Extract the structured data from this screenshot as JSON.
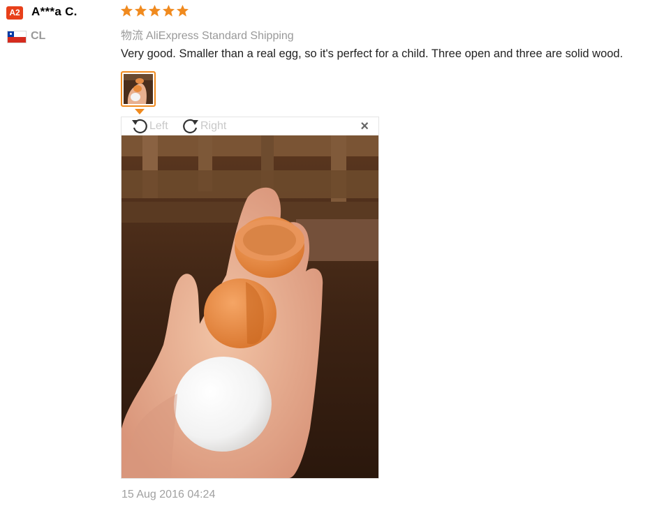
{
  "user": {
    "level": "A2",
    "name": "A***a C.",
    "country_code": "CL",
    "flag": "chile-flag"
  },
  "review": {
    "rating": 5,
    "rating_max": 5,
    "star_color": "#f08a1e",
    "logistics_label": "物流",
    "shipping_method": "AliExpress Standard Shipping",
    "text": "Very good. Smaller than a real egg, so it's perfect for a child. Three open and three are solid wood.",
    "date": "15 Aug 2016 04:24"
  },
  "viewer": {
    "rotate_left_label": "Left",
    "rotate_right_label": "Right",
    "close_symbol": "×",
    "photo_subject": "hand-holding-wooden-eggs"
  },
  "colors": {
    "accent": "#f08a1e",
    "badge": "#e8401a",
    "muted_text": "#999999"
  }
}
